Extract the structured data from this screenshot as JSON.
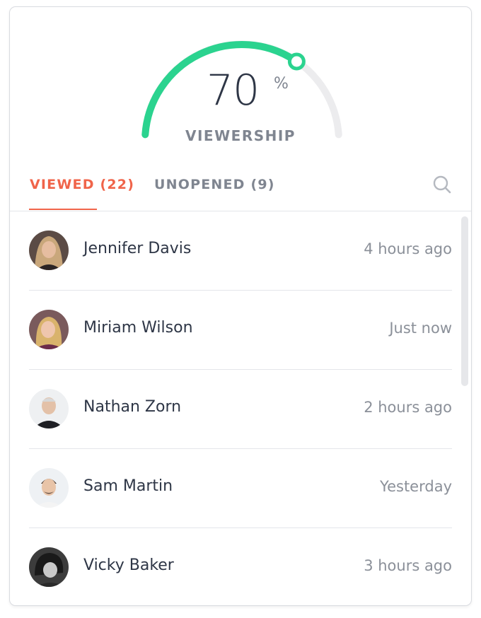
{
  "gauge": {
    "value": 70,
    "value_text": "70",
    "unit": "%",
    "label": "VIEWERSHIP",
    "progress_color": "#2bd38f",
    "track_color": "#ececee"
  },
  "tabs": [
    {
      "label": "VIEWED (22)",
      "active": true
    },
    {
      "label": "UNOPENED (9)",
      "active": false
    }
  ],
  "search": {
    "icon": "search-icon"
  },
  "viewers": [
    {
      "name": "Jennifer Davis",
      "time": "4 hours ago"
    },
    {
      "name": "Miriam Wilson",
      "time": "Just now"
    },
    {
      "name": "Nathan Zorn",
      "time": "2 hours ago"
    },
    {
      "name": "Sam Martin",
      "time": "Yesterday"
    },
    {
      "name": "Vicky Baker",
      "time": "3 hours ago"
    }
  ]
}
